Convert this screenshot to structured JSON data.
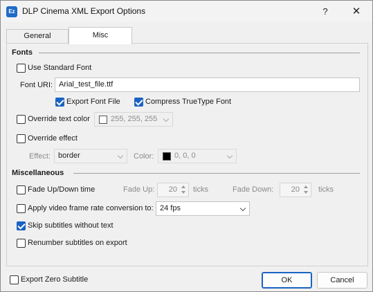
{
  "window": {
    "title": "DLP Cinema XML Export Options",
    "app_icon_text": "Ez",
    "help_label": "?",
    "close_label": "✕"
  },
  "tabs": [
    {
      "label": "General",
      "active": false
    },
    {
      "label": "Misc",
      "active": true
    }
  ],
  "fonts": {
    "section_title": "Fonts",
    "use_standard_font": {
      "label": "Use Standard Font",
      "checked": false
    },
    "font_uri_label": "Font URI:",
    "font_uri_value": "Arial_test_file.ttf",
    "export_font_file": {
      "label": "Export Font File",
      "checked": true
    },
    "compress_truetype": {
      "label": "Compress TrueType Font",
      "checked": true
    },
    "override_text_color": {
      "label": "Override text color",
      "checked": false,
      "color_value": "255, 255, 255",
      "swatch": "#ffffff"
    },
    "override_effect": {
      "label": "Override effect",
      "checked": false
    },
    "effect_label": "Effect:",
    "effect_value": "border",
    "color_label": "Color:",
    "effect_color_value": "0, 0, 0",
    "effect_swatch": "#000000"
  },
  "misc": {
    "section_title": "Miscellaneous",
    "fade": {
      "label": "Fade Up/Down time",
      "checked": false
    },
    "fade_up_label": "Fade Up:",
    "fade_up_value": "20",
    "fade_up_unit": "ticks",
    "fade_down_label": "Fade Down:",
    "fade_down_value": "20",
    "fade_down_unit": "ticks",
    "frame_rate": {
      "label": "Apply video frame rate conversion to:",
      "checked": false,
      "value": "24 fps"
    },
    "skip_subtitles": {
      "label": "Skip subtitles without text",
      "checked": true
    },
    "renumber": {
      "label": "Renumber subtitles on export",
      "checked": false
    }
  },
  "footer": {
    "export_zero": {
      "label": "Export Zero Subtitle",
      "checked": false
    },
    "ok_label": "OK",
    "cancel_label": "Cancel"
  },
  "colors": {
    "accent": "#1a63c2"
  }
}
